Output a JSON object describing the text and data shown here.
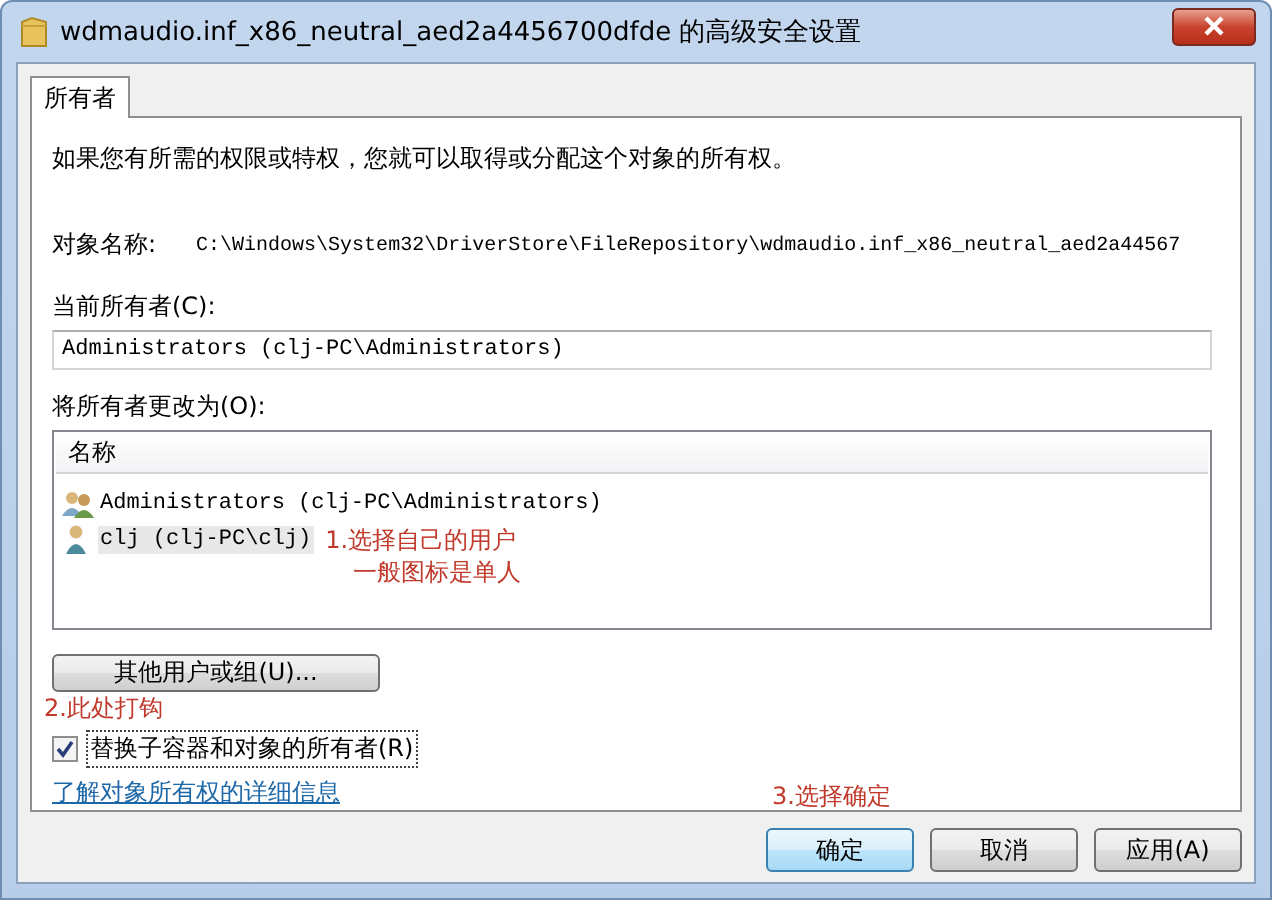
{
  "window": {
    "title": "wdmaudio.inf_x86_neutral_aed2a4456700dfde 的高级安全设置"
  },
  "tabs": [
    {
      "label": "所有者",
      "selected": true
    }
  ],
  "intro": "如果您有所需的权限或特权，您就可以取得或分配这个对象的所有权。",
  "object_name": {
    "label": "对象名称:",
    "value": "C:\\Windows\\System32\\DriverStore\\FileRepository\\wdmaudio.inf_x86_neutral_aed2a44567"
  },
  "current_owner": {
    "label": "当前所有者(C):",
    "value": "Administrators (clj-PC\\Administrators)"
  },
  "change_owner": {
    "label": "将所有者更改为(O):",
    "column": "名称",
    "rows": [
      {
        "name": "Administrators (clj-PC\\Administrators)",
        "kind": "group",
        "selected": false
      },
      {
        "name": "clj (clj-PC\\clj)",
        "kind": "user",
        "selected": true,
        "notes": [
          "1.选择自己的用户",
          "一般图标是单人"
        ]
      }
    ]
  },
  "other_button": "其他用户或组(U)...",
  "replace_checkbox": {
    "label": "替换子容器和对象的所有者(R)",
    "checked": true,
    "note": "2.此处打钩"
  },
  "link": "了解对象所有权的详细信息",
  "buttons": [
    {
      "label": "确定",
      "default": true,
      "note": "3.选择确定"
    },
    {
      "label": "取消",
      "default": false
    },
    {
      "label": "应用(A)",
      "default": false
    }
  ]
}
